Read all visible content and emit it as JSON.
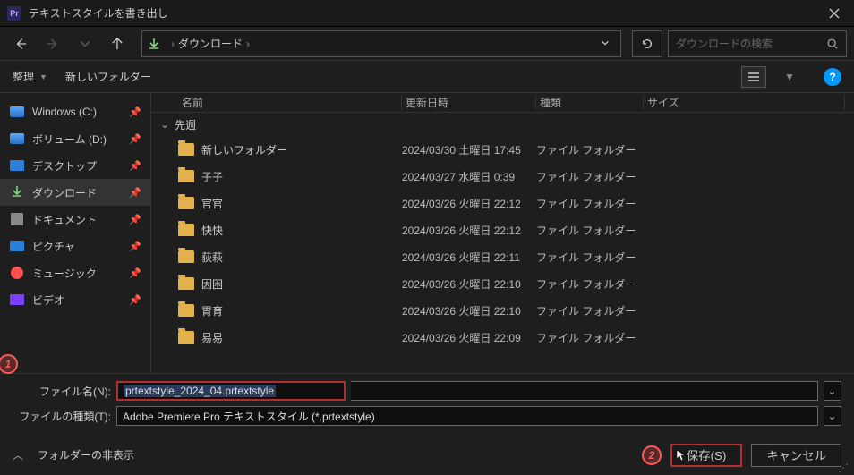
{
  "titlebar": {
    "app_badge": "Pr",
    "title": "テキストスタイルを書き出し"
  },
  "nav": {
    "crumb": "ダウンロード"
  },
  "search": {
    "placeholder": "ダウンロードの検索"
  },
  "toolbar": {
    "organize": "整理",
    "new_folder": "新しいフォルダー",
    "help": "?"
  },
  "columns": {
    "name": "名前",
    "date": "更新日時",
    "type": "種類",
    "size": "サイズ"
  },
  "group": {
    "label": "先週"
  },
  "sidebar": {
    "items": [
      {
        "label": "Windows (C:)",
        "icon": "drive"
      },
      {
        "label": "ボリューム (D:)",
        "icon": "drive"
      },
      {
        "label": "デスクトップ",
        "icon": "desktop"
      },
      {
        "label": "ダウンロード",
        "icon": "download",
        "selected": true
      },
      {
        "label": "ドキュメント",
        "icon": "doc"
      },
      {
        "label": "ピクチャ",
        "icon": "pic"
      },
      {
        "label": "ミュージック",
        "icon": "music"
      },
      {
        "label": "ビデオ",
        "icon": "video"
      }
    ]
  },
  "files": [
    {
      "name": "新しいフォルダー",
      "date": "2024/03/30 土曜日 17:45",
      "type": "ファイル フォルダー"
    },
    {
      "name": "子子",
      "date": "2024/03/27 水曜日 0:39",
      "type": "ファイル フォルダー"
    },
    {
      "name": "官官",
      "date": "2024/03/26 火曜日 22:12",
      "type": "ファイル フォルダー"
    },
    {
      "name": "快快",
      "date": "2024/03/26 火曜日 22:12",
      "type": "ファイル フォルダー"
    },
    {
      "name": "荻萩",
      "date": "2024/03/26 火曜日 22:11",
      "type": "ファイル フォルダー"
    },
    {
      "name": "因困",
      "date": "2024/03/26 火曜日 22:10",
      "type": "ファイル フォルダー"
    },
    {
      "name": "胃育",
      "date": "2024/03/26 火曜日 22:10",
      "type": "ファイル フォルダー"
    },
    {
      "name": "易易",
      "date": "2024/03/26 火曜日 22:09",
      "type": "ファイル フォルダー"
    }
  ],
  "fields": {
    "filename_label": "ファイル名(N):",
    "filename_value": "prtextstyle_2024_04.prtextstyle",
    "filetype_label": "ファイルの種類(T):",
    "filetype_value": "Adobe Premiere Pro テキストスタイル (*.prtextstyle)"
  },
  "footer": {
    "hide_folders": "フォルダーの非表示",
    "save": "保存(S)",
    "cancel": "キャンセル"
  },
  "markers": {
    "one": "1",
    "two": "2"
  },
  "colors": {
    "accent_red": "#b03030",
    "folder": "#e3b24d"
  }
}
